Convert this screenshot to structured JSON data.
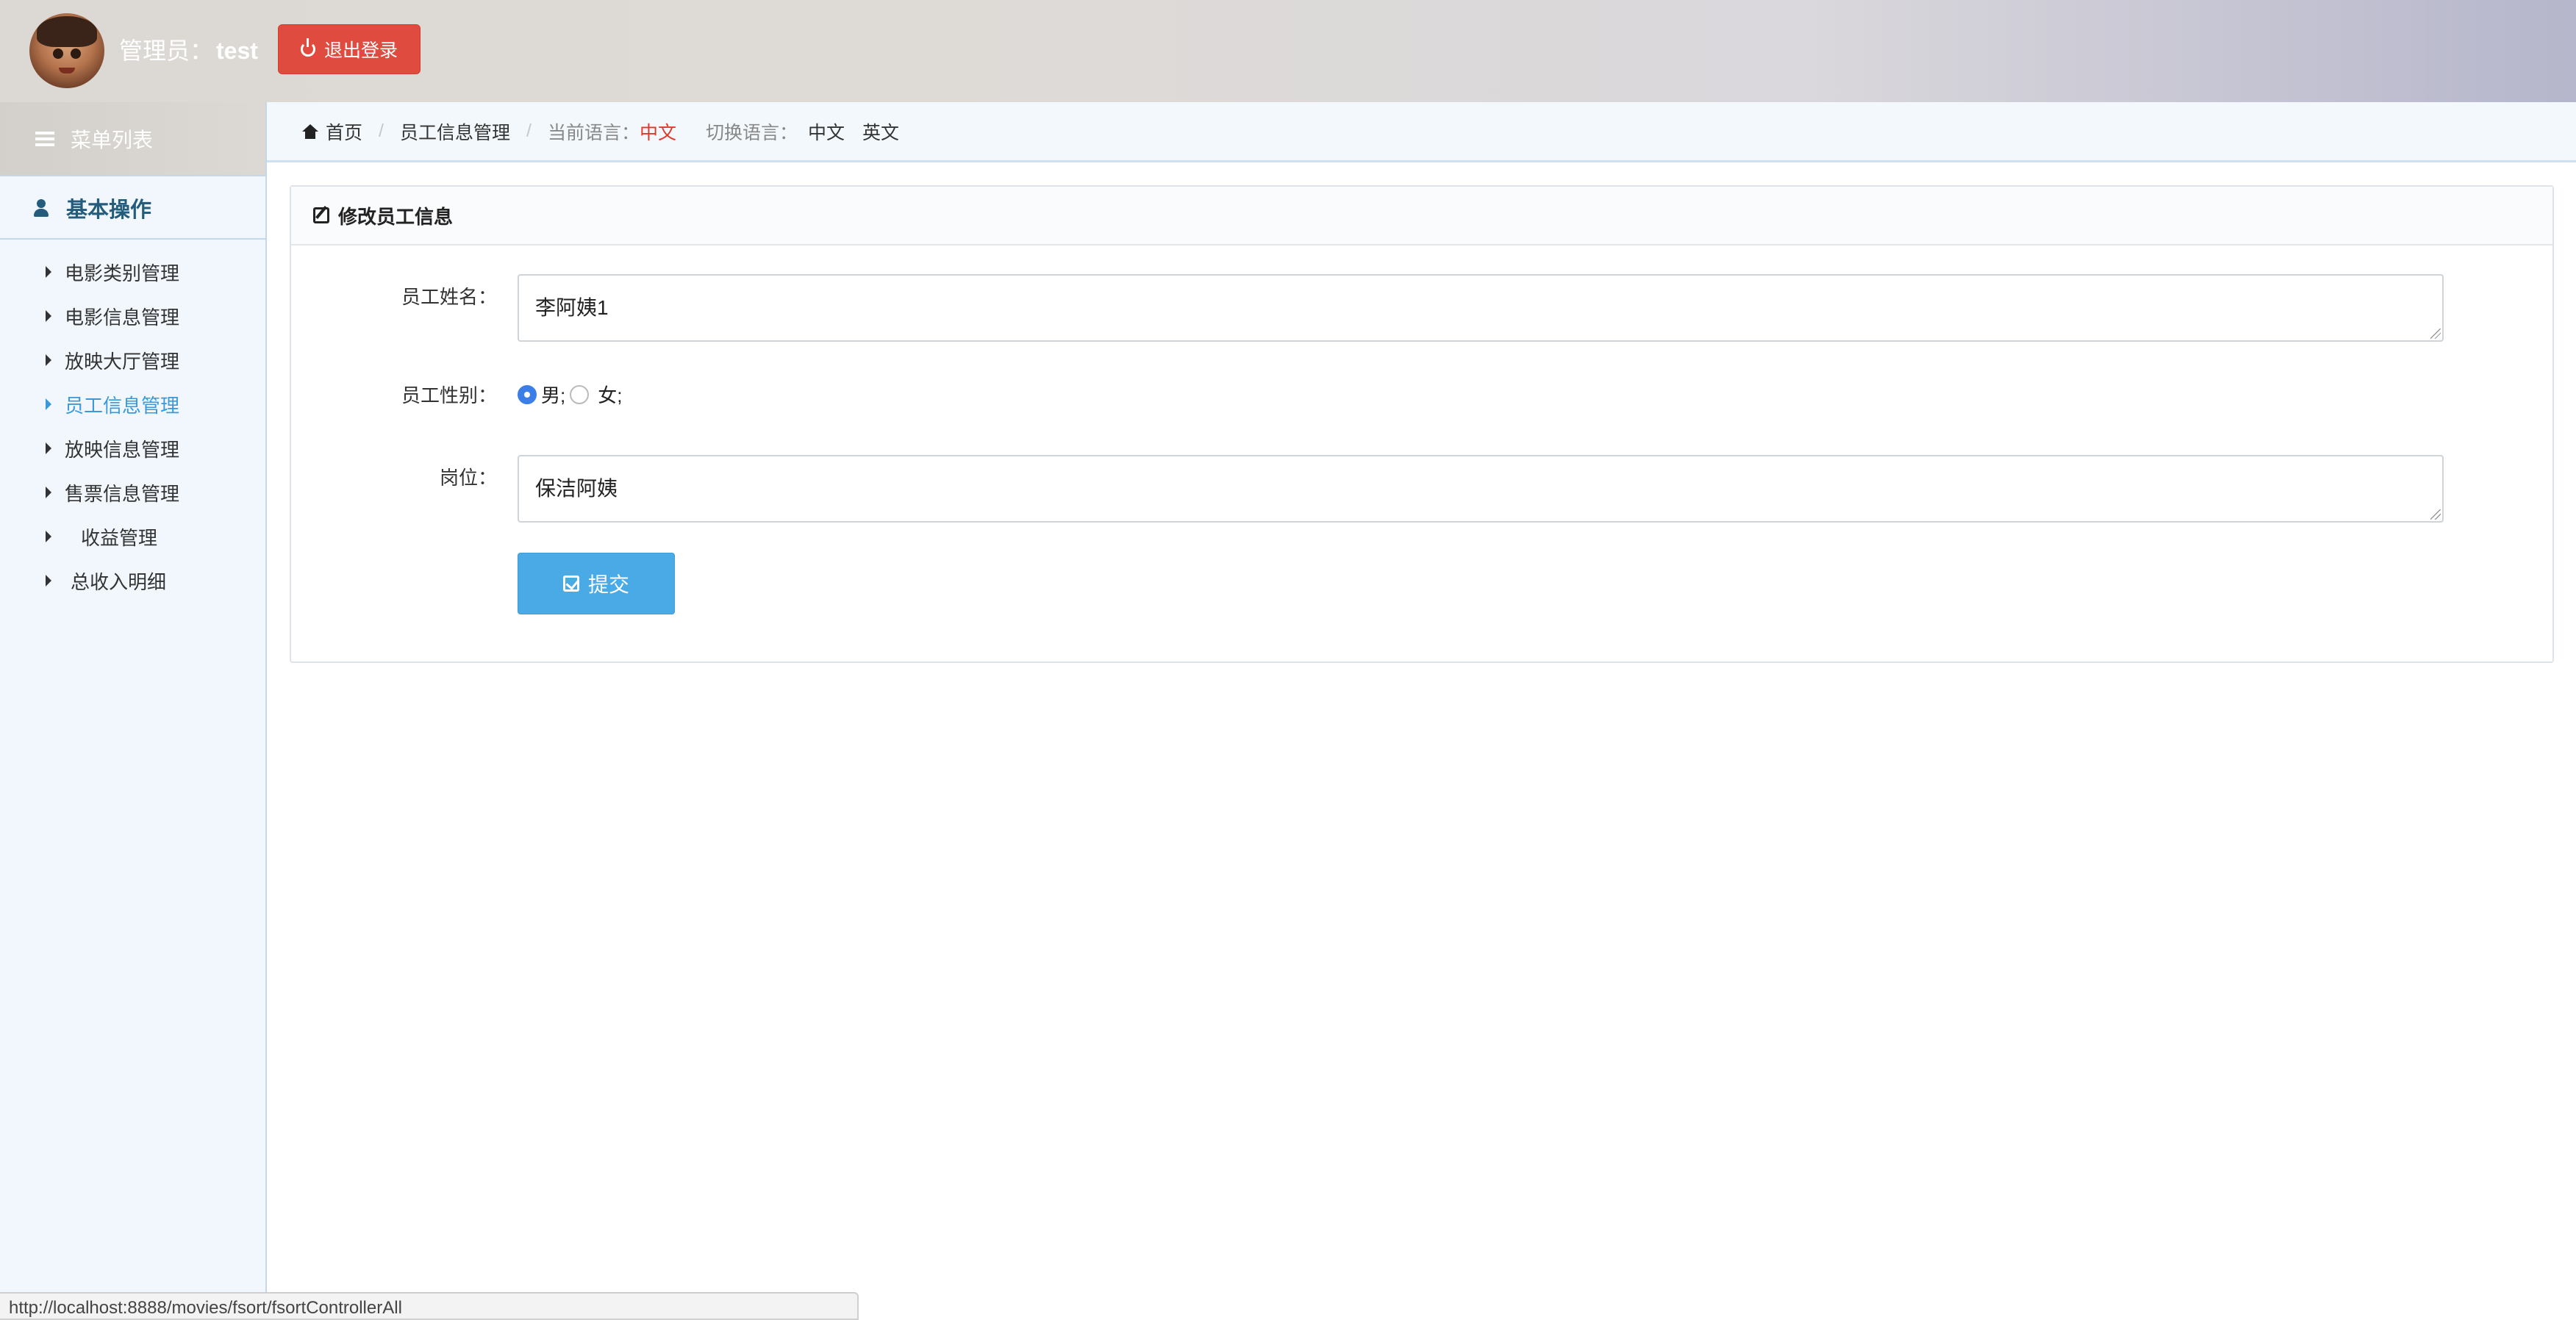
{
  "header": {
    "admin_prefix": "管理员：",
    "admin_name": "test",
    "logout_label": "退出登录",
    "avatar_icon": "avatar-image",
    "logout_icon": "power-icon"
  },
  "sidebar": {
    "menu_title": "菜单列表",
    "group_title": "基本操作",
    "items": [
      {
        "label": "电影类别管理",
        "active": false
      },
      {
        "label": "电影信息管理",
        "active": false
      },
      {
        "label": "放映大厅管理",
        "active": false
      },
      {
        "label": "员工信息管理",
        "active": true
      },
      {
        "label": "放映信息管理",
        "active": false
      },
      {
        "label": "售票信息管理",
        "active": false
      },
      {
        "label": "收益管理",
        "active": false
      },
      {
        "label": "总收入明细",
        "active": false
      }
    ]
  },
  "breadcrumb": {
    "home": "首页",
    "current": "员工信息管理",
    "lang_current_label": "当前语言：",
    "lang_current_value": "中文",
    "lang_switch_label": "切换语言：",
    "lang_options": [
      "中文",
      "英文"
    ]
  },
  "panel": {
    "title": "修改员工信息",
    "fields": {
      "name_label": "员工姓名：",
      "name_value": "李阿姨1",
      "gender_label": "员工性别：",
      "gender_options": [
        "男;",
        "女;"
      ],
      "gender_selected": "男;",
      "position_label": "岗位：",
      "position_value": "保洁阿姨"
    },
    "submit_label": "提交"
  },
  "status_bar": {
    "url": "http://localhost:8888/movies/fsort/fsortControllerAll"
  },
  "colors": {
    "accent": "#3a9ad9",
    "logout": "#e04b3f",
    "submit": "#4aaae6",
    "current_lang": "#e0392b",
    "group_title": "#245c7c"
  }
}
